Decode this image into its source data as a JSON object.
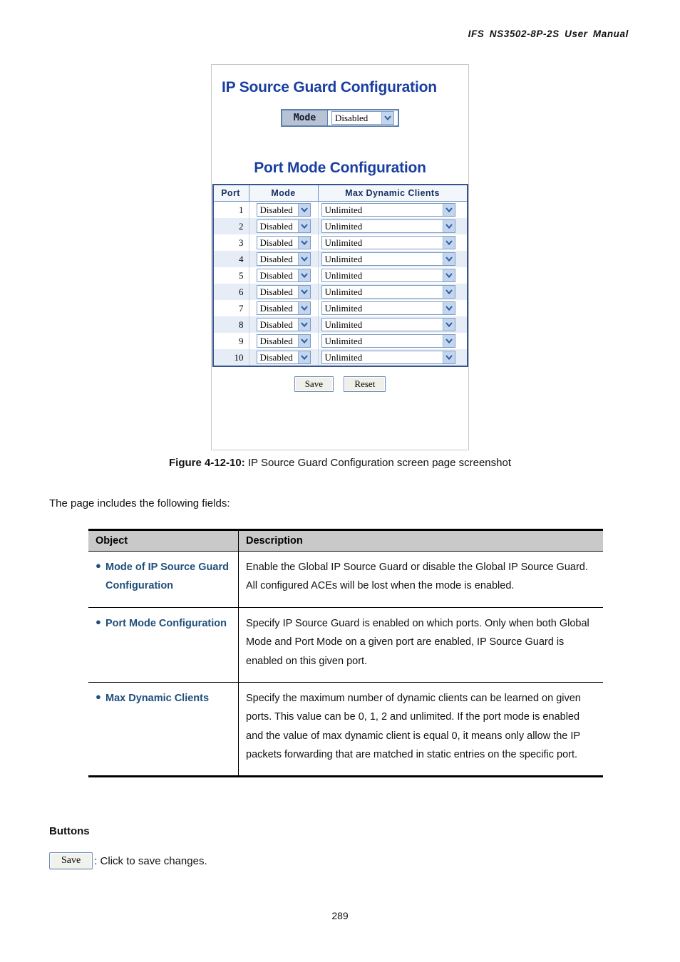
{
  "document": {
    "header": "IFS  NS3502-8P-2S  User  Manual",
    "page_number": "289",
    "intro_text": "The page includes the following fields:",
    "figure_caption_label": "Figure 4-12-10:",
    "figure_caption_text": " IP Source Guard Configuration screen page screenshot"
  },
  "screenshot": {
    "title": "IP Source Guard Configuration",
    "global_mode": {
      "label": "Mode",
      "value": "Disabled"
    },
    "port_section_title": "Port Mode Configuration",
    "port_table": {
      "columns": [
        "Port",
        "Mode",
        "Max Dynamic Clients"
      ],
      "rows": [
        {
          "port": "1",
          "mode": "Disabled",
          "clients": "Unlimited"
        },
        {
          "port": "2",
          "mode": "Disabled",
          "clients": "Unlimited"
        },
        {
          "port": "3",
          "mode": "Disabled",
          "clients": "Unlimited"
        },
        {
          "port": "4",
          "mode": "Disabled",
          "clients": "Unlimited"
        },
        {
          "port": "5",
          "mode": "Disabled",
          "clients": "Unlimited"
        },
        {
          "port": "6",
          "mode": "Disabled",
          "clients": "Unlimited"
        },
        {
          "port": "7",
          "mode": "Disabled",
          "clients": "Unlimited"
        },
        {
          "port": "8",
          "mode": "Disabled",
          "clients": "Unlimited"
        },
        {
          "port": "9",
          "mode": "Disabled",
          "clients": "Unlimited"
        },
        {
          "port": "10",
          "mode": "Disabled",
          "clients": "Unlimited"
        }
      ]
    },
    "save_button": "Save",
    "reset_button": "Reset"
  },
  "description_table": {
    "headers": [
      "Object",
      "Description"
    ],
    "rows": [
      {
        "object": "Mode of IP Source Guard Configuration",
        "description": "Enable the Global IP Source Guard or disable the Global IP Source Guard. All configured ACEs will be lost when the mode is enabled."
      },
      {
        "object": "Port Mode Configuration",
        "description": "Specify IP Source Guard is enabled on which ports. Only when both Global Mode and Port Mode on a given port are enabled, IP Source Guard is enabled on this given port."
      },
      {
        "object": "Max Dynamic Clients",
        "description": "Specify the maximum number of dynamic clients can be learned on given ports. This value can be 0, 1, 2 and unlimited. If the port mode is enabled and the value of max dynamic client is equal 0, it means only allow the IP packets forwarding that are matched in static entries on the specific port."
      }
    ]
  },
  "buttons_section": {
    "heading": "Buttons",
    "save_label": "Save",
    "save_description": ": Click to save changes."
  },
  "colors": {
    "screen_title_blue": "#1a3fa0",
    "object_blue": "#1f4e79",
    "table_header_gray": "#c9c9c9",
    "row_shade": "#e7edf6"
  }
}
